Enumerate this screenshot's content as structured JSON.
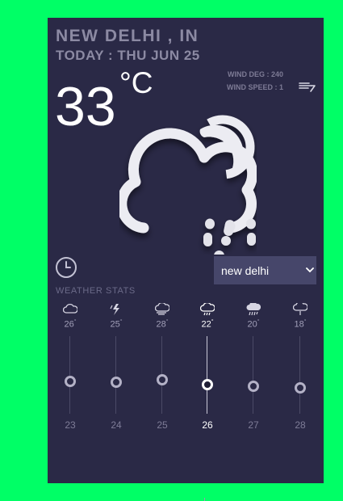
{
  "location": {
    "city": "NEW DELHI , IN",
    "date": "TODAY : THU JUN 25"
  },
  "current": {
    "temperature": "33",
    "unit": "°C"
  },
  "wind": {
    "deg_label": "WIND DEG : 240",
    "speed_label": "WIND SPEED : 1",
    "icon": "wind-icon"
  },
  "main_icon": "cloud-sun-rain-icon",
  "city_select": {
    "selected": "new delhi",
    "options": [
      "new delhi"
    ]
  },
  "stats_label": "WEATHER STATS",
  "forecast": [
    {
      "day": "23",
      "temp": "26",
      "deg": "°",
      "icon": "cloud-icon",
      "level": 0.58,
      "active": false
    },
    {
      "day": "24",
      "temp": "25",
      "deg": "°",
      "icon": "thunder-icon",
      "level": 0.59,
      "active": false
    },
    {
      "day": "25",
      "temp": "28",
      "deg": "°",
      "icon": "cloud-wind-icon",
      "level": 0.56,
      "active": false
    },
    {
      "day": "26",
      "temp": "22",
      "deg": "°",
      "icon": "cloud-rain-icon",
      "level": 0.63,
      "active": true
    },
    {
      "day": "27",
      "temp": "20",
      "deg": "°",
      "icon": "cloud-heavy-rain-icon",
      "level": 0.65,
      "active": false
    },
    {
      "day": "28",
      "temp": "18",
      "deg": "°",
      "icon": "cloud-drizzle-icon",
      "level": 0.67,
      "active": false
    }
  ],
  "colors": {
    "background": "#00ff66",
    "card": "#2a2946",
    "select": "#46466a",
    "text_muted": "#8c8aa3"
  }
}
